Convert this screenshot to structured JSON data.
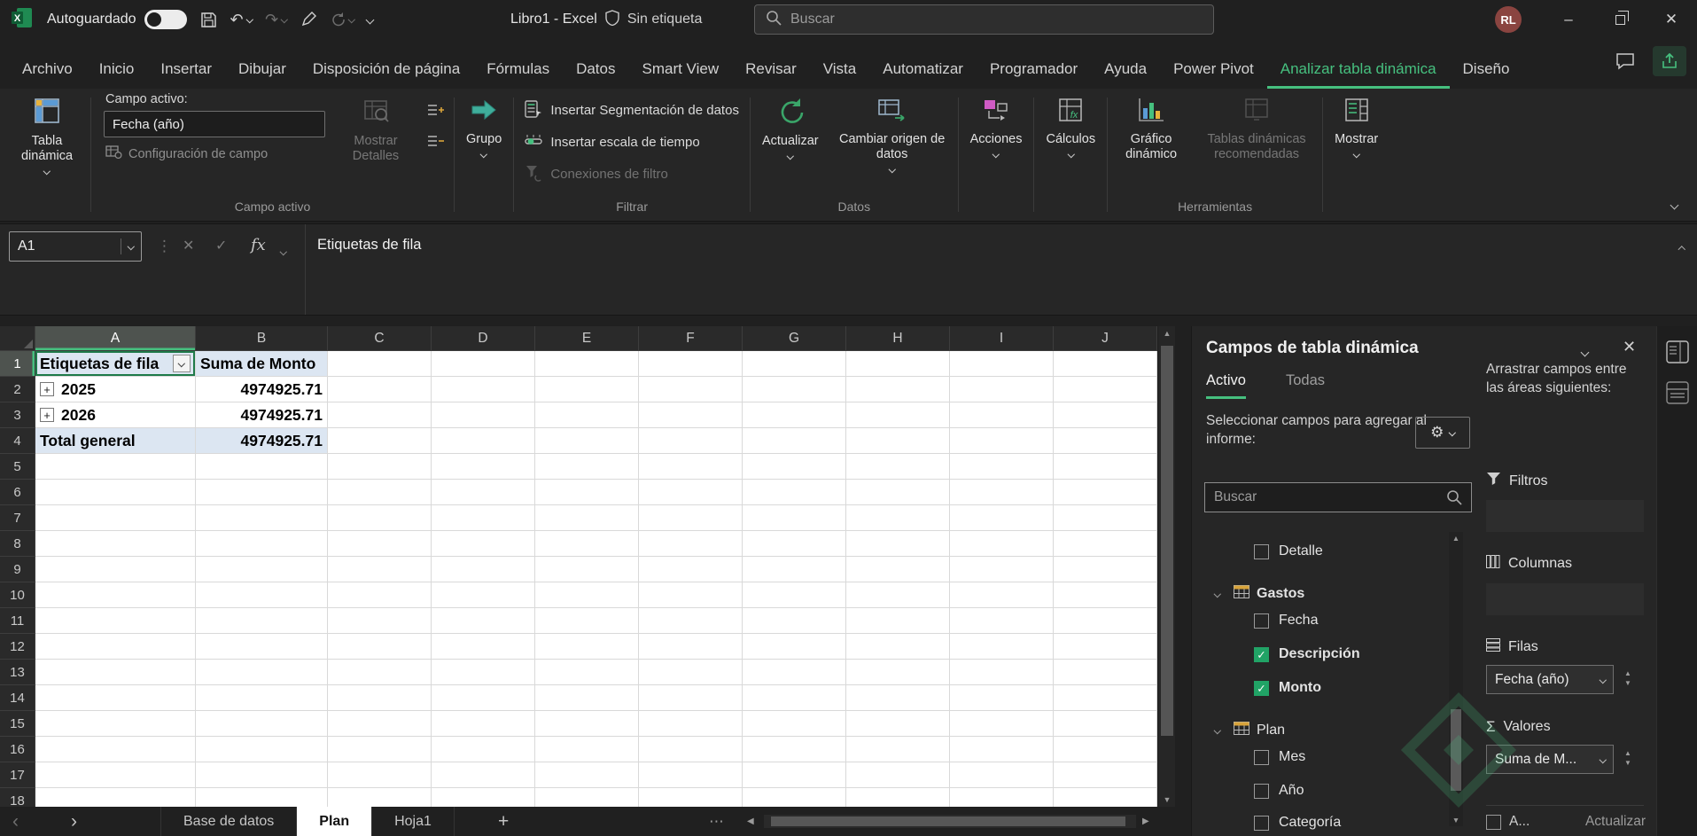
{
  "titlebar": {
    "autosave_label": "Autoguardado",
    "doc_title": "Libro1 - Excel",
    "sensitivity_label": "Sin etiqueta",
    "search_placeholder": "Buscar",
    "avatar_initials": "RL"
  },
  "icons": {
    "minimize": "–",
    "close": "✕",
    "check": "✓",
    "undo": "↶",
    "redo": "↷",
    "sigma": "Σ",
    "gear": "⚙",
    "ellipsis_v": "⋮",
    "more_sheets": "⋯",
    "scroll_up": "▲",
    "scroll_down": "▼",
    "scroll_left": "◀",
    "scroll_right": "▶",
    "prev_sheet": "‹",
    "next_sheet": "›",
    "add_sheet": "+",
    "expand": "+"
  },
  "ribbon": {
    "tabs": [
      "Archivo",
      "Inicio",
      "Insertar",
      "Dibujar",
      "Disposición de página",
      "Fórmulas",
      "Datos",
      "Smart View",
      "Revisar",
      "Vista",
      "Automatizar",
      "Programador",
      "Ayuda",
      "Power Pivot",
      "Analizar tabla dinámica",
      "Diseño"
    ],
    "active_tab": "Analizar tabla dinámica",
    "pivot_table_button": "Tabla dinámica",
    "active_field": {
      "caption": "Campo activo:",
      "value": "Fecha (año)",
      "settings": "Configuración de campo",
      "details": "Mostrar Detalles",
      "group_label": "Campo activo"
    },
    "group_button": "Grupo",
    "filter": {
      "slicer": "Insertar Segmentación de datos",
      "timeline": "Insertar escala de tiempo",
      "connections": "Conexiones de filtro",
      "group_label": "Filtrar"
    },
    "data": {
      "refresh": "Actualizar",
      "change_source": "Cambiar origen de datos",
      "group_label": "Datos"
    },
    "actions_button": "Acciones",
    "calculations_button": "Cálculos",
    "tools": {
      "chart": "Gráfico dinámico",
      "recommended": "Tablas dinámicas recomendadas",
      "group_label": "Herramientas"
    },
    "show_button": "Mostrar"
  },
  "formula_bar": {
    "name_box": "A1",
    "fx_label": "fx",
    "content": "Etiquetas de fila"
  },
  "grid": {
    "columns": [
      "A",
      "B",
      "C",
      "D",
      "E",
      "F",
      "G",
      "H",
      "I",
      "J"
    ],
    "row_count": 18,
    "selected_cell": "A1",
    "pivot": {
      "header_row": [
        "Etiquetas de fila",
        "Suma de Monto"
      ],
      "data_rows": [
        {
          "label": "2025",
          "value": "4974925.71"
        },
        {
          "label": "2026",
          "value": "4974925.71"
        }
      ],
      "total_row": {
        "label": "Total general",
        "value": "4974925.71"
      }
    }
  },
  "sheet_bar": {
    "tabs": [
      "Base de datos",
      "Plan",
      "Hoja1"
    ],
    "active_tab": "Plan"
  },
  "pane": {
    "title": "Campos de tabla dinámica",
    "tabs": {
      "active": "Activo",
      "all": "Todas"
    },
    "drag_hint": "Arrastrar campos entre las áreas siguientes:",
    "select_hint": "Seleccionar campos para agregar al informe:",
    "search_placeholder": "Buscar",
    "fields": [
      {
        "label": "Detalle",
        "kind": "field",
        "checked": false,
        "bold": false
      },
      {
        "label": "Gastos",
        "kind": "table",
        "bold": true
      },
      {
        "label": "Fecha",
        "kind": "field",
        "checked": false,
        "bold": false
      },
      {
        "label": "Descripción",
        "kind": "field",
        "checked": true,
        "bold": true
      },
      {
        "label": "Monto",
        "kind": "field",
        "checked": true,
        "bold": true
      },
      {
        "label": "Plan",
        "kind": "table",
        "bold": false
      },
      {
        "label": "Mes",
        "kind": "field",
        "checked": false,
        "bold": false
      },
      {
        "label": "Año",
        "kind": "field",
        "checked": false,
        "bold": false
      },
      {
        "label": "Categoría",
        "kind": "field",
        "checked": false,
        "bold": false
      }
    ],
    "areas": {
      "filters_label": "Filtros",
      "columns_label": "Columnas",
      "rows_label": "Filas",
      "values_label": "Valores",
      "rows_item": "Fecha (año)",
      "values_item": "Suma de M...",
      "defer_label": "A...",
      "update_button": "Actualizar"
    }
  },
  "colors": {
    "accent_green": "#46c07f",
    "checked_green": "#21a366",
    "pivot_header_bg": "#dce6f2"
  }
}
